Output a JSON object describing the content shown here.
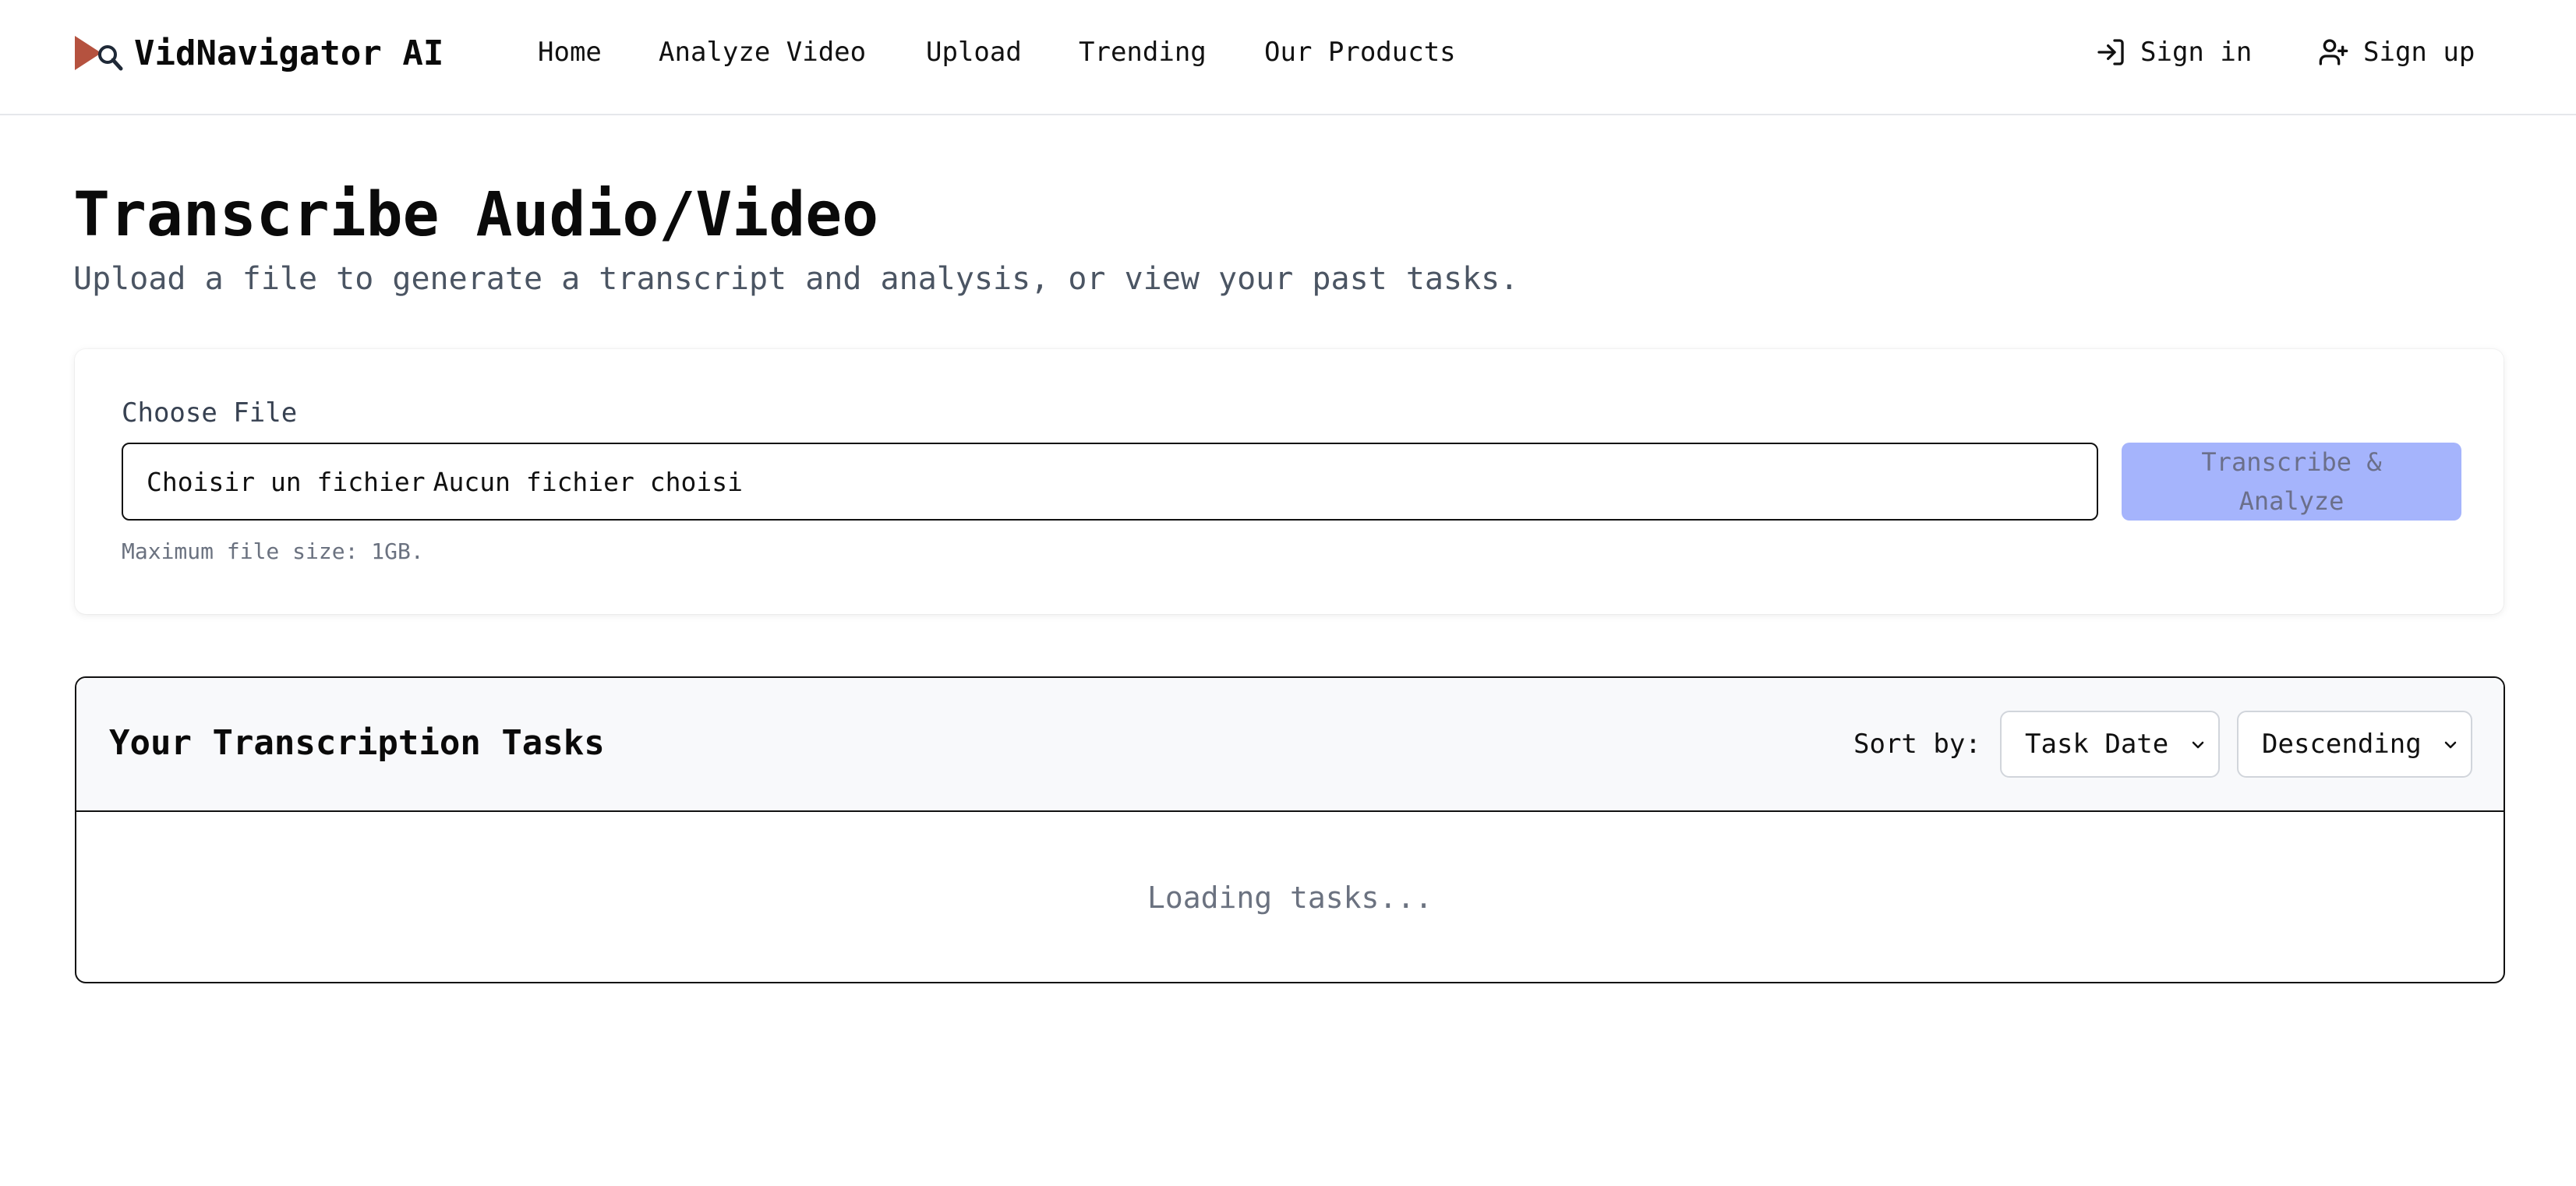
{
  "header": {
    "brand_name": "VidNavigator AI",
    "brand_colors": {
      "play": "#b5523f",
      "magnifier": "#1f2937"
    },
    "nav": [
      {
        "label": "Home"
      },
      {
        "label": "Analyze Video"
      },
      {
        "label": "Upload"
      },
      {
        "label": "Trending"
      },
      {
        "label": "Our Products"
      }
    ],
    "auth": {
      "sign_in": {
        "label": "Sign in",
        "icon": "sign-in-icon"
      },
      "sign_up": {
        "label": "Sign up",
        "icon": "user-plus-icon"
      }
    }
  },
  "page": {
    "title": "Transcribe Audio/Video",
    "subtitle": "Upload a file to generate a transcript and analysis, or view your past tasks."
  },
  "upload": {
    "label": "Choose File",
    "choose_button": "Choisir un fichier",
    "no_file_text": "Aucun fichier choisi",
    "submit_label": "Transcribe & Analyze",
    "submit_disabled": true,
    "submit_color": "#a5b4fc",
    "help_text": "Maximum file size: 1GB."
  },
  "tasks": {
    "title": "Your Transcription Tasks",
    "sort_label": "Sort by:",
    "sort_field": "Task Date",
    "sort_order": "Descending",
    "loading_text": "Loading tasks..."
  }
}
